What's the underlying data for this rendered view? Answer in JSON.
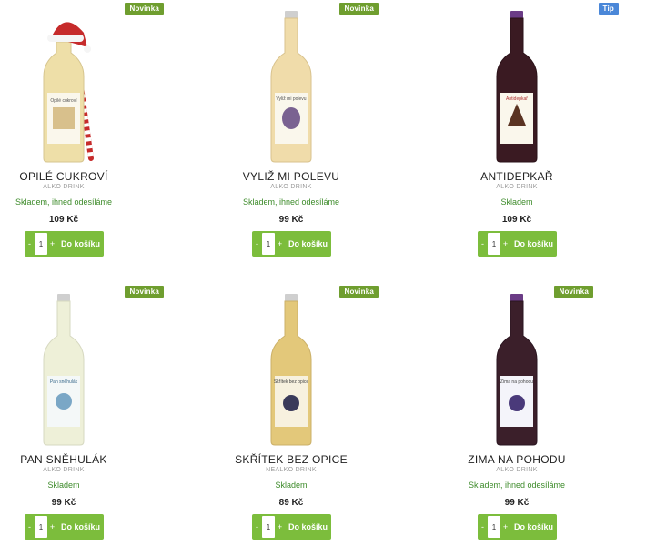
{
  "products": [
    {
      "badge": "Novinka",
      "badge_type": "novinka",
      "name": "OPILÉ CUKROVÍ",
      "category": "ALKO DRINK",
      "stock": "Skladem, ihned odesíláme",
      "price": "109 Kč",
      "qty": "1",
      "minus": "-",
      "plus": "+",
      "cart": "Do košíku",
      "liquid_color": "#eedfa8",
      "cap_color": "#c8c8c8",
      "label_text": "Opilé cukroví",
      "extras": "santa-hat-candy-cane"
    },
    {
      "badge": "Novinka",
      "badge_type": "novinka",
      "name": "VYLIŽ MI POLEVU",
      "category": "ALKO DRINK",
      "stock": "Skladem, ihned odesíláme",
      "price": "99 Kč",
      "qty": "1",
      "minus": "-",
      "plus": "+",
      "cart": "Do košíku",
      "liquid_color": "#f0dcaa",
      "cap_color": "#cfcfcf",
      "label_text": "Vyliž mi polevu"
    },
    {
      "badge": "Tip",
      "badge_type": "tip",
      "name": "ANTIDEPKAŘ",
      "category": "ALKO DRINK",
      "stock": "Skladem",
      "price": "109 Kč",
      "qty": "1",
      "minus": "-",
      "plus": "+",
      "cart": "Do košíku",
      "liquid_color": "#3a1a22",
      "cap_color": "#6b3c86",
      "label_text": "Antidepkař"
    },
    {
      "badge": "Novinka",
      "badge_type": "novinka",
      "name": "PAN SNĚHULÁK",
      "category": "ALKO DRINK",
      "stock": "Skladem",
      "price": "99 Kč",
      "qty": "1",
      "minus": "-",
      "plus": "+",
      "cart": "Do košíku",
      "liquid_color": "#eef0d8",
      "cap_color": "#cfcfcf",
      "label_text": "Pan sněhulák"
    },
    {
      "badge": "Novinka",
      "badge_type": "novinka",
      "name": "SKŘÍTEK BEZ OPICE",
      "category": "NEALKO DRINK",
      "stock": "Skladem",
      "price": "89 Kč",
      "qty": "1",
      "minus": "-",
      "plus": "+",
      "cart": "Do košíku",
      "liquid_color": "#e3c87a",
      "cap_color": "#cfcfcf",
      "label_text": "Skřítek bez opice"
    },
    {
      "badge": "Novinka",
      "badge_type": "novinka",
      "name": "ZIMA NA POHODU",
      "category": "ALKO DRINK",
      "stock": "Skladem, ihned odesíláme",
      "price": "99 Kč",
      "qty": "1",
      "minus": "-",
      "plus": "+",
      "cart": "Do košíku",
      "liquid_color": "#3b1f2a",
      "cap_color": "#6b3c86",
      "label_text": "Zima na pohodu"
    }
  ]
}
